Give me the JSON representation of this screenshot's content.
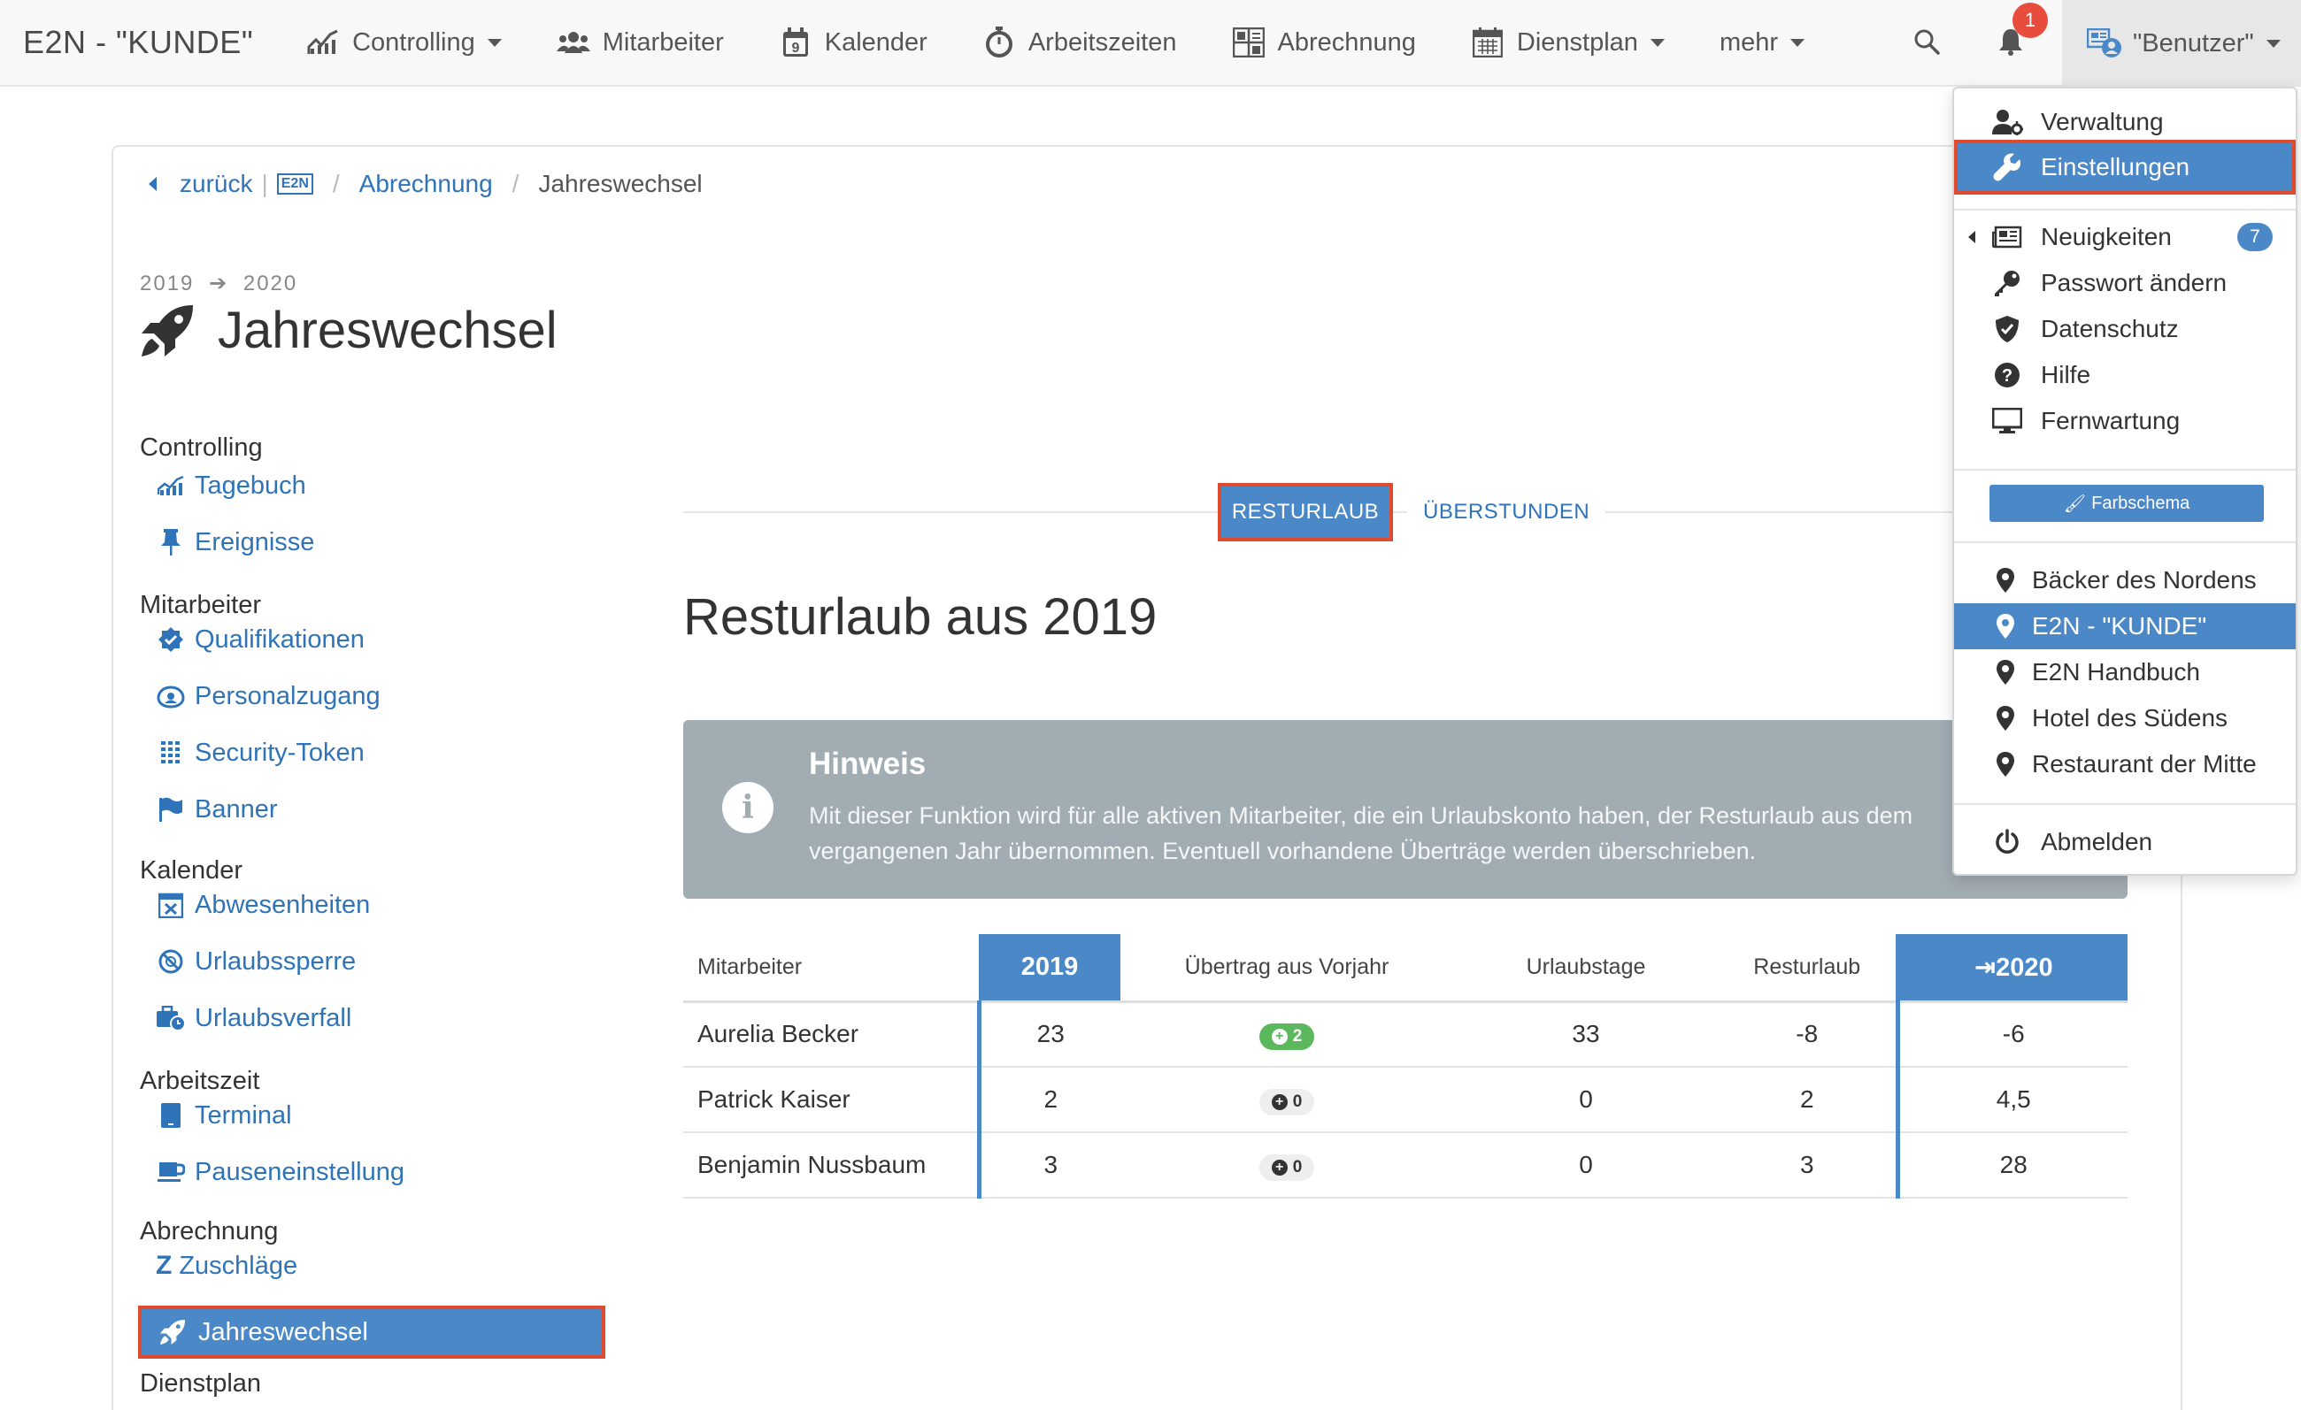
{
  "navbar": {
    "brand": "E2N - \"KUNDE\"",
    "items": [
      {
        "label": "Controlling",
        "icon": "chart-line-icon",
        "dropdown": true
      },
      {
        "label": "Mitarbeiter",
        "icon": "users-icon",
        "dropdown": false
      },
      {
        "label": "Kalender",
        "icon": "calendar-day-icon",
        "dropdown": false
      },
      {
        "label": "Arbeitszeiten",
        "icon": "stopwatch-icon",
        "dropdown": false
      },
      {
        "label": "Abrechnung",
        "icon": "abrechnung-icon",
        "dropdown": false
      },
      {
        "label": "Dienstplan",
        "icon": "calendar-grid-icon",
        "dropdown": true
      },
      {
        "label": "mehr",
        "icon": "",
        "dropdown": true
      }
    ],
    "notification_count": "1",
    "user_label": "\"Benutzer\""
  },
  "breadcrumb": {
    "back": "zurück",
    "e2n_badge": "E2N",
    "parent": "Abrechnung",
    "current": "Jahreswechsel"
  },
  "header": {
    "year_from": "2019",
    "arrow": "➔",
    "year_to": "2020",
    "title": "Jahreswechsel"
  },
  "sidebar": {
    "groups": [
      {
        "label": "Controlling",
        "links": [
          {
            "label": "Tagebuch",
            "icon": "chart-area-icon"
          },
          {
            "label": "Ereignisse",
            "icon": "thumbtack-icon"
          }
        ]
      },
      {
        "label": "Mitarbeiter",
        "links": [
          {
            "label": "Qualifikationen",
            "icon": "badge-check-icon"
          },
          {
            "label": "Personalzugang",
            "icon": "user-access-icon"
          },
          {
            "label": "Security-Token",
            "icon": "keypad-icon"
          },
          {
            "label": "Banner",
            "icon": "flag-icon"
          }
        ]
      },
      {
        "label": "Kalender",
        "links": [
          {
            "label": "Abwesenheiten",
            "icon": "calendar-x-icon"
          },
          {
            "label": "Urlaubssperre",
            "icon": "ban-clock-icon"
          },
          {
            "label": "Urlaubsverfall",
            "icon": "suitcase-clock-icon"
          }
        ]
      },
      {
        "label": "Arbeitszeit",
        "links": [
          {
            "label": "Terminal",
            "icon": "tablet-icon"
          },
          {
            "label": "Pauseneinstellung",
            "icon": "coffee-icon"
          }
        ]
      },
      {
        "label": "Abrechnung",
        "links": [
          {
            "label": "Zuschläge",
            "icon": "z-icon"
          },
          {
            "label": "Jahreswechsel",
            "icon": "rocket-icon",
            "active": true
          }
        ]
      },
      {
        "label": "Dienstplan",
        "links": []
      }
    ]
  },
  "tabs": {
    "active": "RESTURLAUB",
    "other": "ÜBERSTUNDEN"
  },
  "section_title": "Resturlaub aus 2019",
  "hint": {
    "title": "Hinweis",
    "text": "Mit dieser Funktion wird für alle aktiven Mitarbeiter, die ein Urlaubskonto haben, der Resturlaub aus dem vergangenen Jahr übernommen. Eventuell vorhandene Überträge werden überschrieben."
  },
  "table": {
    "columns": [
      "Mitarbeiter",
      "2019",
      "Übertrag aus Vorjahr",
      "Urlaubstage",
      "Resturlaub",
      "2020"
    ],
    "rows": [
      {
        "name": "Aurelia Becker",
        "y2019": "23",
        "uebertrag": "2",
        "uebertrag_style": "green",
        "urlaubstage": "33",
        "resturlaub": "-8",
        "y2020": "-6"
      },
      {
        "name": "Patrick Kaiser",
        "y2019": "2",
        "uebertrag": "0",
        "uebertrag_style": "grey",
        "urlaubstage": "0",
        "resturlaub": "2",
        "y2020": "4,5"
      },
      {
        "name": "Benjamin Nussbaum",
        "y2019": "3",
        "uebertrag": "0",
        "uebertrag_style": "grey",
        "urlaubstage": "0",
        "resturlaub": "3",
        "y2020": "28"
      }
    ]
  },
  "dropdown": {
    "items_top": [
      {
        "label": "Verwaltung",
        "icon": "user-cog-icon"
      },
      {
        "label": "Einstellungen",
        "icon": "wrench-icon",
        "highlighted": true
      }
    ],
    "items_mid": [
      {
        "label": "Neuigkeiten",
        "icon": "newspaper-icon",
        "badge": "7"
      },
      {
        "label": "Passwort ändern",
        "icon": "key-icon"
      },
      {
        "label": "Datenschutz",
        "icon": "shield-check-icon"
      },
      {
        "label": "Hilfe",
        "icon": "question-circle-icon"
      },
      {
        "label": "Fernwartung",
        "icon": "desktop-icon"
      }
    ],
    "farbschema_label": "Farbschema",
    "locations": [
      {
        "label": "Bäcker des Nordens"
      },
      {
        "label": "E2N - \"KUNDE\"",
        "selected": true
      },
      {
        "label": "E2N Handbuch"
      },
      {
        "label": "Hotel des Südens"
      },
      {
        "label": "Restaurant der Mitte"
      }
    ],
    "logout": "Abmelden"
  },
  "colors": {
    "accent": "#4a88c7",
    "link": "#2f73b8",
    "highlight_border": "#e04a2f",
    "hint_bg": "#a2adb3",
    "success": "#5cb85c",
    "danger": "#e74c3c"
  }
}
